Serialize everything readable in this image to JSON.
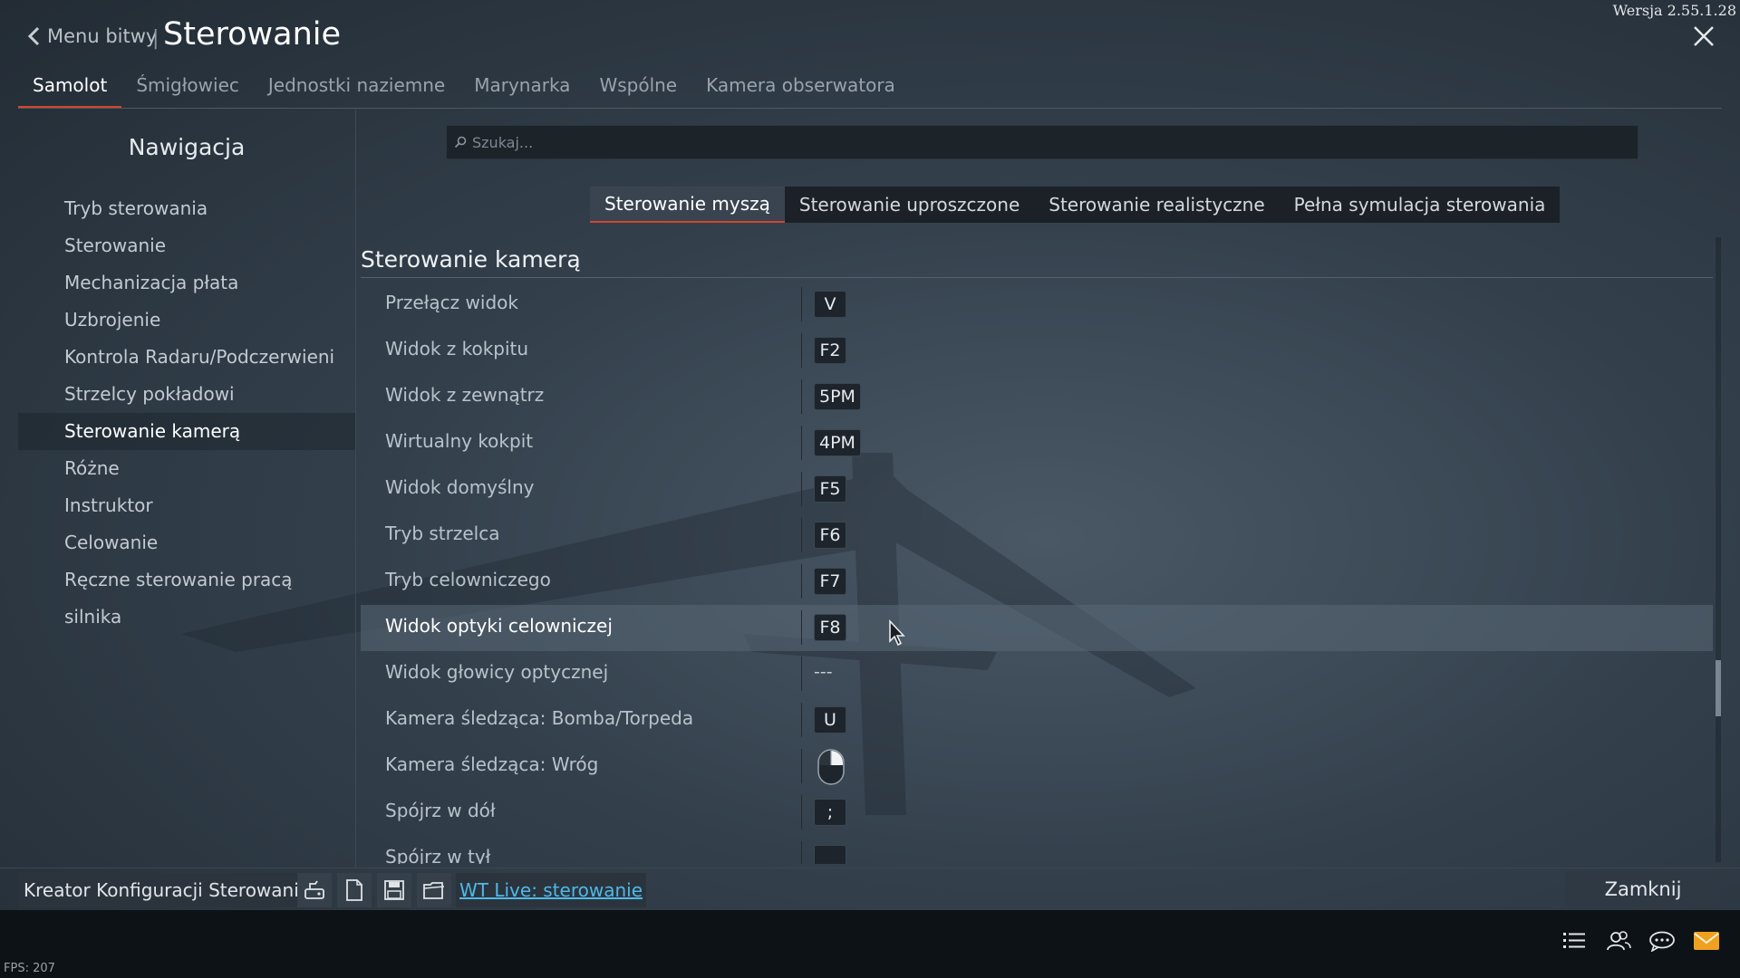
{
  "header": {
    "back_label": "Menu bitwy",
    "separator": "|",
    "title": "Sterowanie",
    "version": "Wersja 2.55.1.28"
  },
  "tabs": [
    {
      "label": "Samolot",
      "active": true
    },
    {
      "label": "Śmigłowiec"
    },
    {
      "label": "Jednostki naziemne"
    },
    {
      "label": "Marynarka"
    },
    {
      "label": "Wspólne"
    },
    {
      "label": "Kamera obserwatora"
    }
  ],
  "nav": {
    "title": "Nawigacja",
    "items": [
      {
        "label": "Tryb sterowania"
      },
      {
        "label": "Sterowanie"
      },
      {
        "label": "Mechanizacja płata"
      },
      {
        "label": "Uzbrojenie"
      },
      {
        "label": "Kontrola Radaru/Podczerwieni"
      },
      {
        "label": "Strzelcy pokładowi"
      },
      {
        "label": "Sterowanie kamerą",
        "active": true
      },
      {
        "label": "Różne"
      },
      {
        "label": "Instruktor"
      },
      {
        "label": "Celowanie"
      },
      {
        "label": "Ręczne sterowanie pracą silnika"
      }
    ]
  },
  "search": {
    "placeholder": "Szukaj..."
  },
  "modes": [
    {
      "label": "Sterowanie myszą",
      "active": true
    },
    {
      "label": "Sterowanie uproszczone"
    },
    {
      "label": "Sterowanie realistyczne"
    },
    {
      "label": "Pełna symulacja sterowania"
    }
  ],
  "section_title": "Sterowanie kamerą",
  "bindings": [
    {
      "label": "Przełącz widok",
      "key": "V"
    },
    {
      "label": "Widok z kokpitu",
      "key": "F2"
    },
    {
      "label": "Widok z zewnątrz",
      "key": "5PM"
    },
    {
      "label": "Wirtualny kokpit",
      "key": "4PM"
    },
    {
      "label": "Widok domyślny",
      "key": "F5"
    },
    {
      "label": "Tryb strzelca",
      "key": "F6"
    },
    {
      "label": "Tryb celowniczego",
      "key": "F7"
    },
    {
      "label": "Widok optyki celowniczej",
      "key": "F8",
      "highlighted": true
    },
    {
      "label": "Widok głowicy optycznej",
      "unbound": "---"
    },
    {
      "label": "Kamera śledząca: Bomba/Torpeda",
      "key": "U"
    },
    {
      "label": "Kamera śledząca: Wróg",
      "icon": "mouse-left-button-icon"
    },
    {
      "label": "Spójrz w dół",
      "key": ";"
    },
    {
      "label": "Spójrz w tył",
      "key": ""
    }
  ],
  "bottom": {
    "kreator_label": "Kreator Konfiguracji Sterowania",
    "icons": [
      "controller-icon",
      "new-file-icon",
      "save-icon",
      "open-folder-icon"
    ],
    "wt_live_label": "WT Live: sterowanie",
    "close_label": "Zamknij"
  },
  "footer": {
    "fps": "FPS: 207",
    "icons": [
      "list-icon",
      "friends-icon",
      "chat-icon",
      "mail-icon"
    ]
  },
  "colors": {
    "accent": "#d2452c",
    "link": "#4fb8e8",
    "mail": "#f0a020"
  }
}
